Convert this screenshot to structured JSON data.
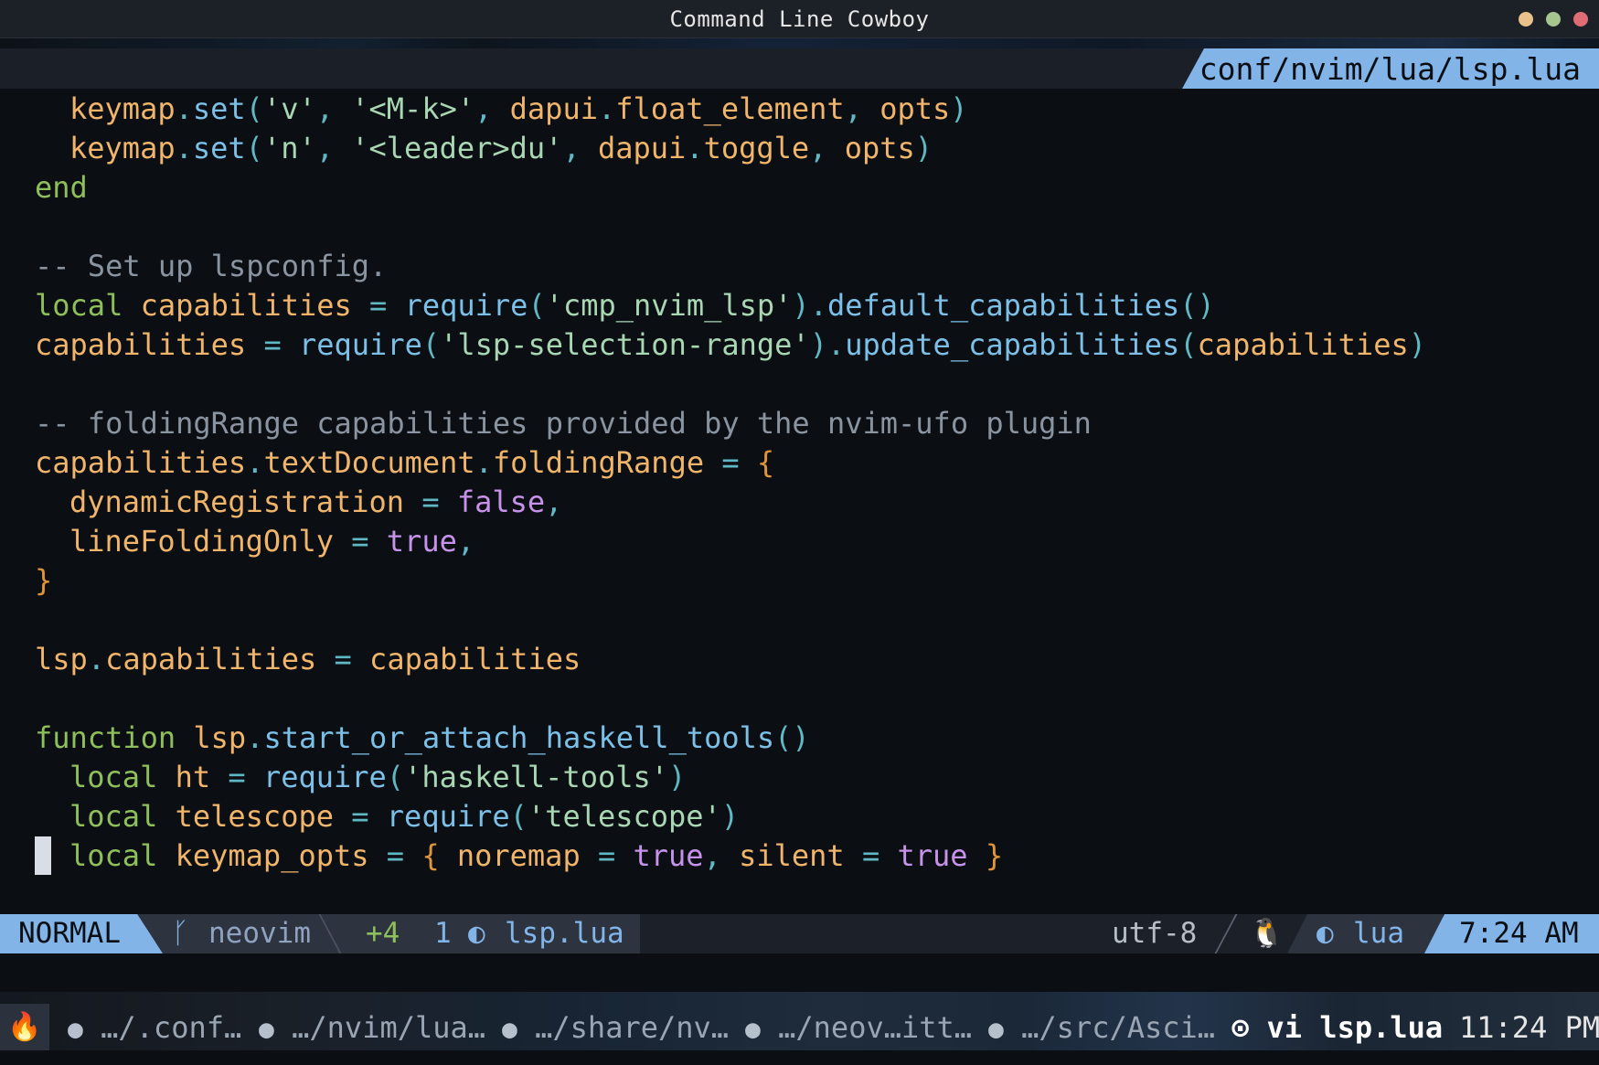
{
  "window": {
    "title": "Command Line Cowboy"
  },
  "tabline": {
    "file_path": "conf/nvim/lua/lsp.lua"
  },
  "code": {
    "l1": {
      "a": "keymap",
      "b": ".",
      "c": "set",
      "d": "(",
      "e": "'v'",
      "f": ", ",
      "g": "'<M-k>'",
      "h": ", ",
      "i": "dapui",
      "j": ".",
      "k": "float_element",
      "l": ", ",
      "m": "opts",
      "n": ")"
    },
    "l2": {
      "a": "keymap",
      "b": ".",
      "c": "set",
      "d": "(",
      "e": "'n'",
      "f": ", ",
      "g": "'<leader>du'",
      "h": ", ",
      "i": "dapui",
      "j": ".",
      "k": "toggle",
      "l": ", ",
      "m": "opts",
      "n": ")"
    },
    "l3": {
      "a": "end"
    },
    "l5": {
      "a": "-- Set up lspconfig."
    },
    "l6": {
      "a": "local",
      "b": " capabilities",
      "c": " = ",
      "d": "require",
      "e": "(",
      "f": "'cmp_nvim_lsp'",
      "g": ")",
      "h": ".",
      "i": "default_capabilities",
      "j": "()"
    },
    "l7": {
      "a": "capabilities",
      "b": " = ",
      "c": "require",
      "d": "(",
      "e": "'lsp-selection-range'",
      "f": ")",
      "g": ".",
      "h": "update_capabilities",
      "i": "(",
      "j": "capabilities",
      "k": ")"
    },
    "l9": {
      "a": "-- foldingRange capabilities provided by the nvim-ufo plugin"
    },
    "l10": {
      "a": "capabilities",
      "b": ".",
      "c": "textDocument",
      "d": ".",
      "e": "foldingRange",
      "f": " = ",
      "g": "{"
    },
    "l11": {
      "a": "dynamicRegistration",
      "b": " = ",
      "c": "false",
      "d": ","
    },
    "l12": {
      "a": "lineFoldingOnly",
      "b": " = ",
      "c": "true",
      "d": ","
    },
    "l13": {
      "a": "}"
    },
    "l15": {
      "a": "lsp",
      "b": ".",
      "c": "capabilities",
      "d": " = ",
      "e": "capabilities"
    },
    "l17": {
      "a": "function",
      "b": " lsp",
      "c": ".",
      "d": "start_or_attach_haskell_tools",
      "e": "()"
    },
    "l18": {
      "a": "local",
      "b": " ht",
      "c": " = ",
      "d": "require",
      "e": "(",
      "f": "'haskell-tools'",
      "g": ")"
    },
    "l19": {
      "a": "local",
      "b": " telescope",
      "c": " = ",
      "d": "require",
      "e": "(",
      "f": "'telescope'",
      "g": ")"
    },
    "l20": {
      "a": "local",
      "b": " keymap_opts",
      "c": " = ",
      "d": "{",
      "e": " noremap",
      "f": " = ",
      "g": "true",
      "h": ", ",
      "i": "silent",
      "j": " = ",
      "k": "true",
      "l": " }"
    }
  },
  "statusline": {
    "mode": "NORMAL",
    "branch_icon": "ᚴ",
    "branch": "neovim",
    "diff": "+4",
    "diagnostics": "1",
    "file_icon": "◐",
    "filename": "lsp.lua",
    "encoding": "utf-8",
    "os_icon": "🐧",
    "filetype_icon": "◐",
    "filetype": "lua",
    "clock": "7:24 AM"
  },
  "tmux": {
    "flame_icon": "🔥",
    "windows": [
      {
        "label": "…/.conf…"
      },
      {
        "label": "…/nvim/lua…"
      },
      {
        "label": "…/share/nv…"
      },
      {
        "label": "…/neov…itt…"
      },
      {
        "label": "…/src/Asci…"
      }
    ],
    "active_icon": "⊙",
    "active": "vi lsp.lua",
    "time": "11:24 PM"
  }
}
